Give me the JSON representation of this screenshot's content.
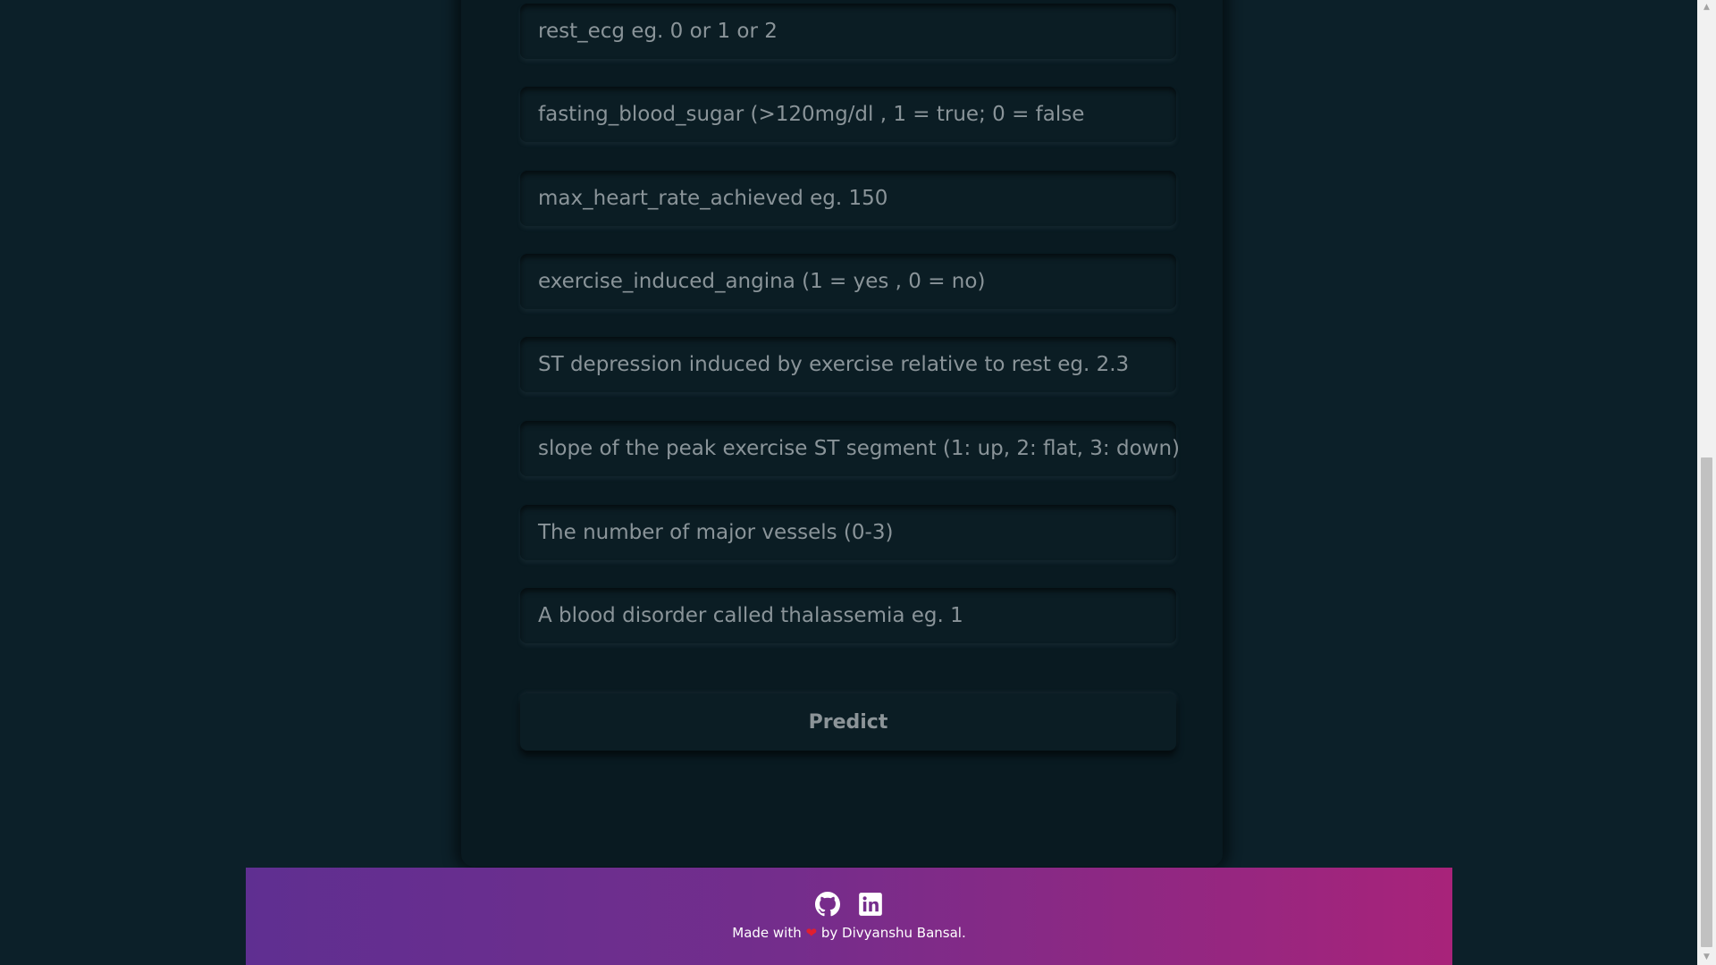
{
  "form": {
    "fields": [
      {
        "placeholder": "rest_ecg eg. 0 or 1 or 2"
      },
      {
        "placeholder": "fasting_blood_sugar (>120mg/dl , 1 = true; 0 = false"
      },
      {
        "placeholder": "max_heart_rate_achieved eg. 150"
      },
      {
        "placeholder": "exercise_induced_angina (1 = yes , 0 = no)"
      },
      {
        "placeholder": "ST depression induced by exercise relative to rest eg. 2.3"
      },
      {
        "placeholder": "slope of the peak exercise ST segment (1: up, 2: flat, 3: down)"
      },
      {
        "placeholder": "The number of major vessels (0-3)"
      },
      {
        "placeholder": "A blood disorder called thalassemia eg. 1"
      }
    ],
    "submit_label": "Predict"
  },
  "footer": {
    "made_with": "Made with",
    "by_text": "by Divyanshu Bansal.",
    "icons": [
      "github-icon",
      "linkedin-icon",
      "heart-icon"
    ]
  },
  "colors": {
    "background": "#0c2029",
    "card": "#091a21",
    "placeholder_text": "#8a9499",
    "footer_gradient_start": "#5f2f91",
    "footer_gradient_end": "#a8237a",
    "heart": "#e01f2f"
  }
}
